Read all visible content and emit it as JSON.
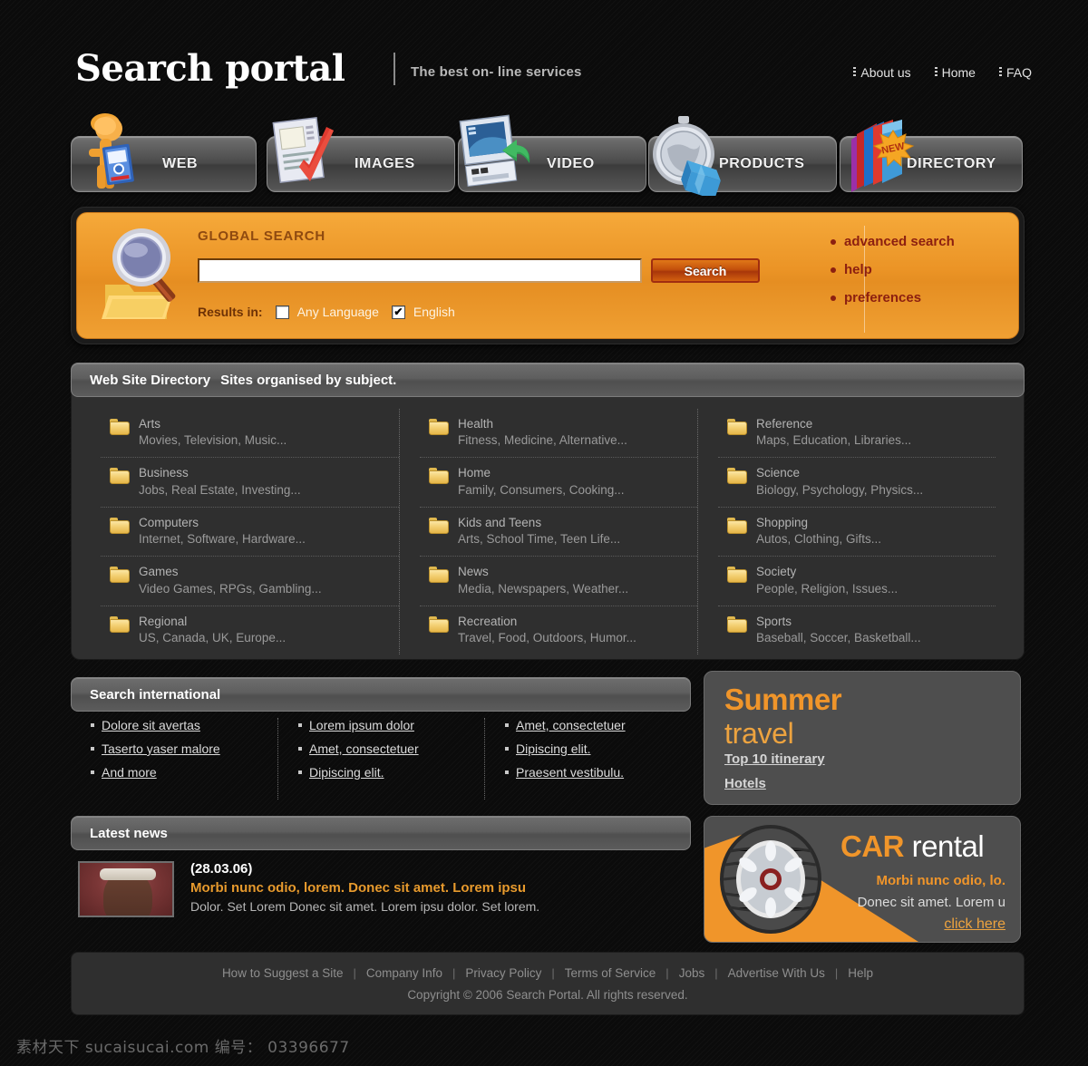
{
  "header": {
    "logo": "Search portal",
    "tagline": "The best on- line services",
    "nav": [
      {
        "label": "About us"
      },
      {
        "label": "Home"
      },
      {
        "label": "FAQ"
      }
    ]
  },
  "tabs": [
    {
      "label": "WEB",
      "icon": "person-book-icon"
    },
    {
      "label": "IMAGES",
      "icon": "document-checkmark-icon"
    },
    {
      "label": "VIDEO",
      "icon": "monitor-arrow-icon"
    },
    {
      "label": "PRODUCTS",
      "icon": "stopwatch-box-icon"
    },
    {
      "label": "DIRECTORY",
      "icon": "books-new-badge-icon"
    }
  ],
  "search": {
    "icon": "magnifier-folder-icon",
    "heading": "GLOBAL SEARCH",
    "input_value": "",
    "input_placeholder": "",
    "button_label": "Search",
    "results_label": "Results in:",
    "options": [
      {
        "label": "Any Language",
        "checked": false
      },
      {
        "label": "English",
        "checked": true
      }
    ],
    "quicklinks": [
      {
        "label": "advanced search"
      },
      {
        "label": "help"
      },
      {
        "label": "preferences"
      }
    ],
    "colors": {
      "panel": "#eb9426",
      "button": "#c4500c",
      "link": "#8c1f10"
    }
  },
  "directory": {
    "title": "Web Site Directory",
    "subtitle": "Sites organised by subject.",
    "columns": [
      [
        {
          "name": "Arts",
          "sub": "Movies, Television, Music..."
        },
        {
          "name": "Business",
          "sub": "Jobs, Real Estate, Investing..."
        },
        {
          "name": "Computers",
          "sub": "Internet, Software, Hardware..."
        },
        {
          "name": "Games",
          "sub": "Video Games, RPGs, Gambling..."
        },
        {
          "name": "Regional",
          "sub": "US, Canada, UK, Europe..."
        }
      ],
      [
        {
          "name": "Health",
          "sub": "Fitness, Medicine, Alternative..."
        },
        {
          "name": "Home",
          "sub": "Family, Consumers, Cooking..."
        },
        {
          "name": "Kids and Teens",
          "sub": "Arts, School Time, Teen Life..."
        },
        {
          "name": "News",
          "sub": "Media, Newspapers, Weather..."
        },
        {
          "name": "Recreation",
          "sub": "Travel, Food, Outdoors, Humor..."
        }
      ],
      [
        {
          "name": "Reference",
          "sub": "Maps, Education, Libraries..."
        },
        {
          "name": "Science",
          "sub": "Biology, Psychology, Physics..."
        },
        {
          "name": "Shopping",
          "sub": "Autos, Clothing, Gifts..."
        },
        {
          "name": "Society",
          "sub": "People, Religion, Issues..."
        },
        {
          "name": "Sports",
          "sub": "Baseball, Soccer, Basketball..."
        }
      ]
    ]
  },
  "international": {
    "title": "Search international",
    "columns": [
      [
        {
          "label": "Dolore sit avertas"
        },
        {
          "label": "Taserto yaser malore"
        },
        {
          "label": "And more"
        }
      ],
      [
        {
          "label": "Lorem ipsum dolor"
        },
        {
          "label": "Amet, consectetuer"
        },
        {
          "label": "Dipiscing elit."
        }
      ],
      [
        {
          "label": "Amet, consectetuer"
        },
        {
          "label": "Dipiscing elit."
        },
        {
          "label": "Praesent vestibulu."
        }
      ]
    ]
  },
  "summer": {
    "line1": "Summer",
    "line2": "travel",
    "link1": "Top 10 itinerary",
    "link2": "Hotels",
    "accent": "#f0952a"
  },
  "news": {
    "title": "Latest news",
    "date": "(28.03.06)",
    "headline": "Morbi nunc odio, lorem.  Donec sit amet. Lorem ipsu",
    "description": "Dolor. Set Lorem Donec sit amet. Lorem ipsu dolor. Set lorem.",
    "thumb": "news-portrait-thumbnail"
  },
  "car": {
    "title_accent": "CAR",
    "title_rest": " rental",
    "sub1": "Morbi nunc odio, lo.",
    "sub2": "Donec sit amet. Lorem u",
    "cta": "click here",
    "image": "car-tire-icon",
    "accent": "#f0952a"
  },
  "footer": {
    "links": [
      {
        "label": "How to Suggest a Site"
      },
      {
        "label": "Company Info"
      },
      {
        "label": "Privacy Policy"
      },
      {
        "label": "Terms of Service"
      },
      {
        "label": "Jobs"
      },
      {
        "label": "Advertise With Us"
      },
      {
        "label": "Help"
      }
    ],
    "separator": "|",
    "copyright": "Copyright © 2006 Search Portal. All rights reserved."
  },
  "watermark": "素材天下 sucaisucai.com  编号： 03396677"
}
